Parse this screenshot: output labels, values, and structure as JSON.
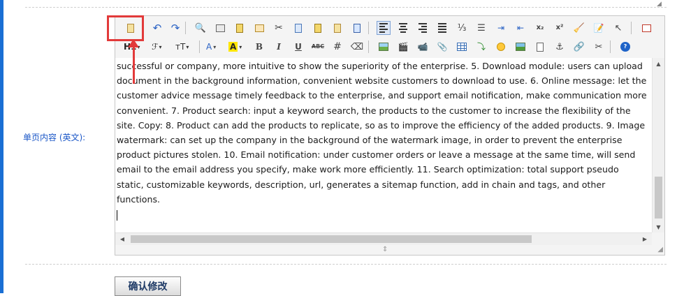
{
  "field": {
    "label": "单页内容 (英文):"
  },
  "toolbar": {
    "heading_label": "H1",
    "font_family_label": "ℱ",
    "font_size_label": "тT",
    "font_color_label": "A",
    "highlight_label": "A",
    "bold_label": "B",
    "italic_label": "I",
    "underline_label": "U",
    "strikethrough_label": "ABC",
    "subscript_label": "x₂",
    "superscript_label": "x²",
    "help_label": "?"
  },
  "editor": {
    "content": "successful or company, more intuitive to show the superiority of the enterprise. 5. Download module: users can upload document in the background information, convenient website customers to download to use. 6. Online message: let the customer advice message timely feedback to the enterprise, and support email notification, make communication more convenient. 7. Product search: input a keyword search, the products to the customer to increase the flexibility of the site. Copy: 8. Product can add the products to replicate, so as to improve the efficiency of the added products. 9. Image watermark: can set up the company in the background of the watermark image, in order to prevent the enterprise product pictures stolen. 10. Email notification: under customer orders or leave a message at the same time, will send email to the email address you specify, make work more efficiently. 11. Search optimization: total support pseudo static, customizable keywords, description, url, generates a sitemap function, add in chain and tags, and other functions."
  },
  "submit": {
    "label": "确认修改"
  },
  "annotation": {
    "color": "#e23a3a",
    "target": "paste-as-plain-text-button"
  }
}
